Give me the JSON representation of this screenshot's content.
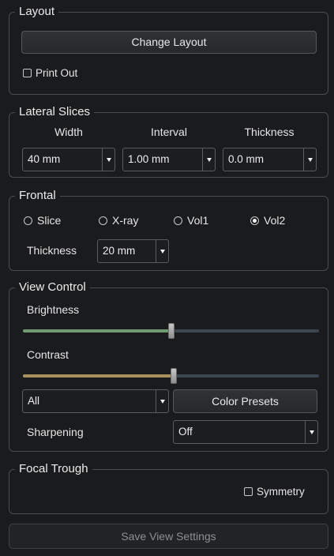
{
  "layout": {
    "title": "Layout",
    "change_layout": "Change Layout",
    "print_out": {
      "label": "Print Out",
      "checked": false
    }
  },
  "lateral": {
    "title": "Lateral Slices",
    "columns": [
      "Width",
      "Interval",
      "Thickness"
    ],
    "width": "40 mm",
    "interval": "1.00 mm",
    "thickness": "0.0 mm"
  },
  "frontal": {
    "title": "Frontal",
    "modes": [
      {
        "label": "Slice",
        "selected": false
      },
      {
        "label": "X-ray",
        "selected": false
      },
      {
        "label": "Vol1",
        "selected": false
      },
      {
        "label": "Vol2",
        "selected": true
      }
    ],
    "thickness_label": "Thickness",
    "thickness": "20 mm"
  },
  "view_control": {
    "title": "View Control",
    "brightness": {
      "label": "Brightness",
      "fraction": 0.5,
      "color": "#6f9a72"
    },
    "contrast": {
      "label": "Contrast",
      "fraction": 0.51,
      "color": "#a8935e"
    },
    "channel": "All",
    "color_presets": "Color Presets",
    "sharpening_label": "Sharpening",
    "sharpening": "Off"
  },
  "focal_trough": {
    "title": "Focal Trough",
    "symmetry": {
      "label": "Symmetry",
      "checked": false
    }
  },
  "save_view_settings": "Save View Settings"
}
